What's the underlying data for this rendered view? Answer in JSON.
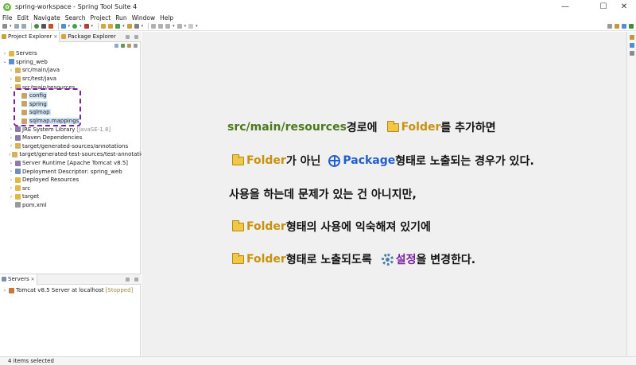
{
  "window": {
    "title": "spring-workspace - Spring Tool Suite 4",
    "minimize": "—",
    "maximize": "☐",
    "close": "✕"
  },
  "menu": [
    "File",
    "Edit",
    "Navigate",
    "Search",
    "Project",
    "Run",
    "Window",
    "Help"
  ],
  "left_panel": {
    "tabs": [
      {
        "label": "Project Explorer",
        "close": "✕"
      },
      {
        "label": "Package Explorer",
        "close": ""
      }
    ],
    "tree": [
      {
        "label": "Servers",
        "arrow": "›",
        "icon": "folder-icon"
      },
      {
        "label": "spring_web",
        "arrow": "⌄",
        "icon": "project-icon"
      },
      {
        "label": "src/main/java",
        "arrow": "›",
        "icon": "source-folder-icon"
      },
      {
        "label": "src/test/java",
        "arrow": "›",
        "icon": "source-folder-icon"
      },
      {
        "label": "src/main/resources",
        "arrow": "⌄",
        "icon": "source-folder-icon"
      },
      {
        "label": "config",
        "arrow": "",
        "icon": "package-icon"
      },
      {
        "label": "spring",
        "arrow": "",
        "icon": "package-icon"
      },
      {
        "label": "sqlmap",
        "arrow": "",
        "icon": "package-icon"
      },
      {
        "label": "sqlmap.mappings",
        "arrow": "",
        "icon": "package-icon"
      },
      {
        "label": "JRE System Library",
        "decor": "[JavaSE-1.8]",
        "arrow": "›",
        "icon": "library-icon"
      },
      {
        "label": "Maven Dependencies",
        "arrow": "›",
        "icon": "library-icon"
      },
      {
        "label": "target/generated-sources/annotations",
        "arrow": "›",
        "icon": "source-folder-icon"
      },
      {
        "label": "target/generated-test-sources/test-annotations",
        "arrow": "›",
        "icon": "source-folder-icon"
      },
      {
        "label": "Server Runtime [Apache Tomcat v8.5]",
        "arrow": "›",
        "icon": "library-icon"
      },
      {
        "label": "Deployment Descriptor: spring_web",
        "arrow": "›",
        "icon": "descriptor-icon"
      },
      {
        "label": "Deployed Resources",
        "arrow": "›",
        "icon": "folder-icon"
      },
      {
        "label": "src",
        "arrow": "›",
        "icon": "folder-icon"
      },
      {
        "label": "target",
        "arrow": "›",
        "icon": "folder-icon"
      },
      {
        "label": "pom.xml",
        "arrow": "",
        "icon": "xml-file-icon"
      }
    ]
  },
  "servers_panel": {
    "tab_label": "Servers",
    "tab_close": "✕",
    "server": {
      "name": "Tomcat v8.5 Server at localhost",
      "state": "[Stopped]"
    }
  },
  "status_bar": {
    "text": "4 items selected"
  },
  "annotation": {
    "line1": {
      "path": "src/main/resources",
      "t1": " 경로에 ",
      "folder": "Folder",
      "t2": "를 추가하면"
    },
    "line2": {
      "folder": "Folder",
      "t1": "가 아닌 ",
      "package": "Package",
      "t2": " 형태로 노출되는 경우가 있다."
    },
    "line3": {
      "text": "사용을 하는데 문제가 있는 건 아니지만,"
    },
    "line4": {
      "folder": "Folder",
      "t1": " 형태의 사용에 익숙해져 있기에"
    },
    "line5": {
      "folder": "Folder",
      "t1": " 형태로 노출되도록 ",
      "setting": "설정",
      "t2": "을 변경한다."
    }
  },
  "colors": {
    "highlight_box": "#7b1fa2",
    "selection": "#cfe4f7",
    "editor_bg": "#f0f0f0"
  }
}
